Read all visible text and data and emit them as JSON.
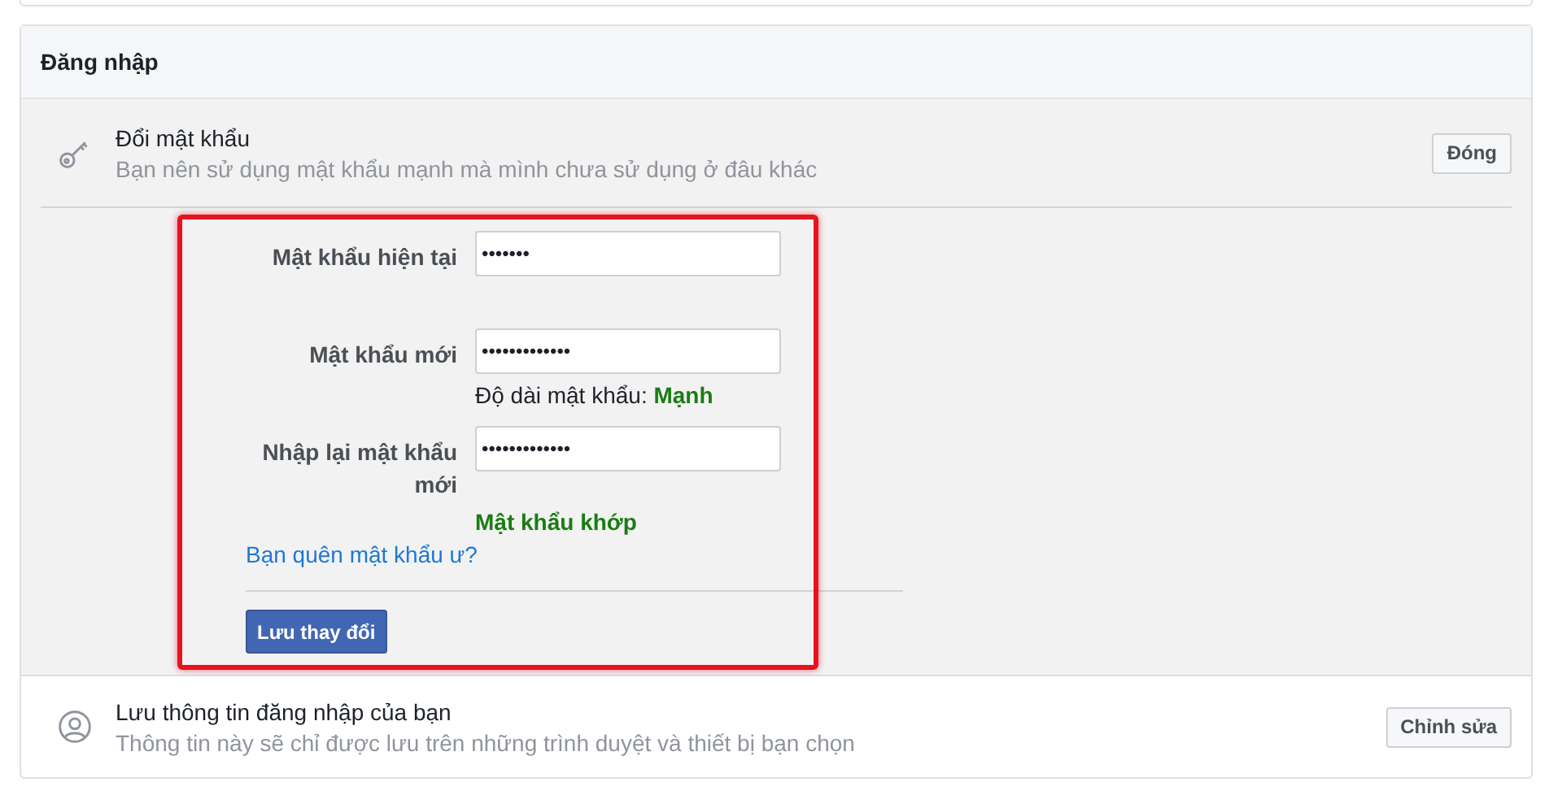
{
  "section": {
    "title": "Đăng nhập"
  },
  "change_password": {
    "title": "Đổi mật khẩu",
    "description": "Bạn nên sử dụng mật khẩu mạnh mà mình chưa sử dụng ở đâu khác",
    "button": "Đóng",
    "fields": [
      {
        "label": "Mật khẩu hiện tại",
        "value": "•••••••"
      },
      {
        "label": "Mật khẩu mới",
        "value": "•••••••••••••",
        "hint": "Độ dài mật khẩu: ",
        "hint_strong": "Mạnh"
      },
      {
        "label": "Nhập lại mật khẩu mới",
        "value": "•••••••••••••",
        "status": "Mật khẩu khớp"
      }
    ],
    "forgot_link": "Bạn quên mật khẩu ư?",
    "save_button": "Lưu thay đổi"
  },
  "save_login": {
    "title": "Lưu thông tin đăng nhập của bạn",
    "description": "Thông tin này sẽ chỉ được lưu trên những trình duyệt và thiết bị bạn chọn",
    "button": "Chỉnh sửa"
  }
}
